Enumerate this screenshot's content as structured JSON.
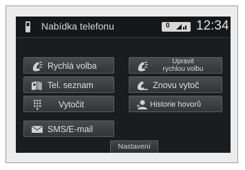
{
  "statusbar": {
    "title": "Nabídka telefonu",
    "signal_text": "0",
    "clock": "12:34"
  },
  "buttons": {
    "quick_dial": "Rychlá volba",
    "edit_quick_dial_line1": "Upravit",
    "edit_quick_dial_line2": "rychlou volbu",
    "phonebook": "Tel. seznam",
    "redial": "Znovu vytoč",
    "dial": "Vytočit",
    "call_history": "Historie hovorů",
    "sms_email": "SMS/E-mail"
  },
  "footer": {
    "settings": "Nastavení"
  },
  "icons": {
    "quick_dial": "handset-speed-icon",
    "edit_quick_dial": "handset-speed-icon",
    "phonebook": "book-icon",
    "redial": "handset-redial-icon",
    "dial": "keypad-icon",
    "call_history": "person-history-icon",
    "sms_email": "envelope-icon"
  }
}
